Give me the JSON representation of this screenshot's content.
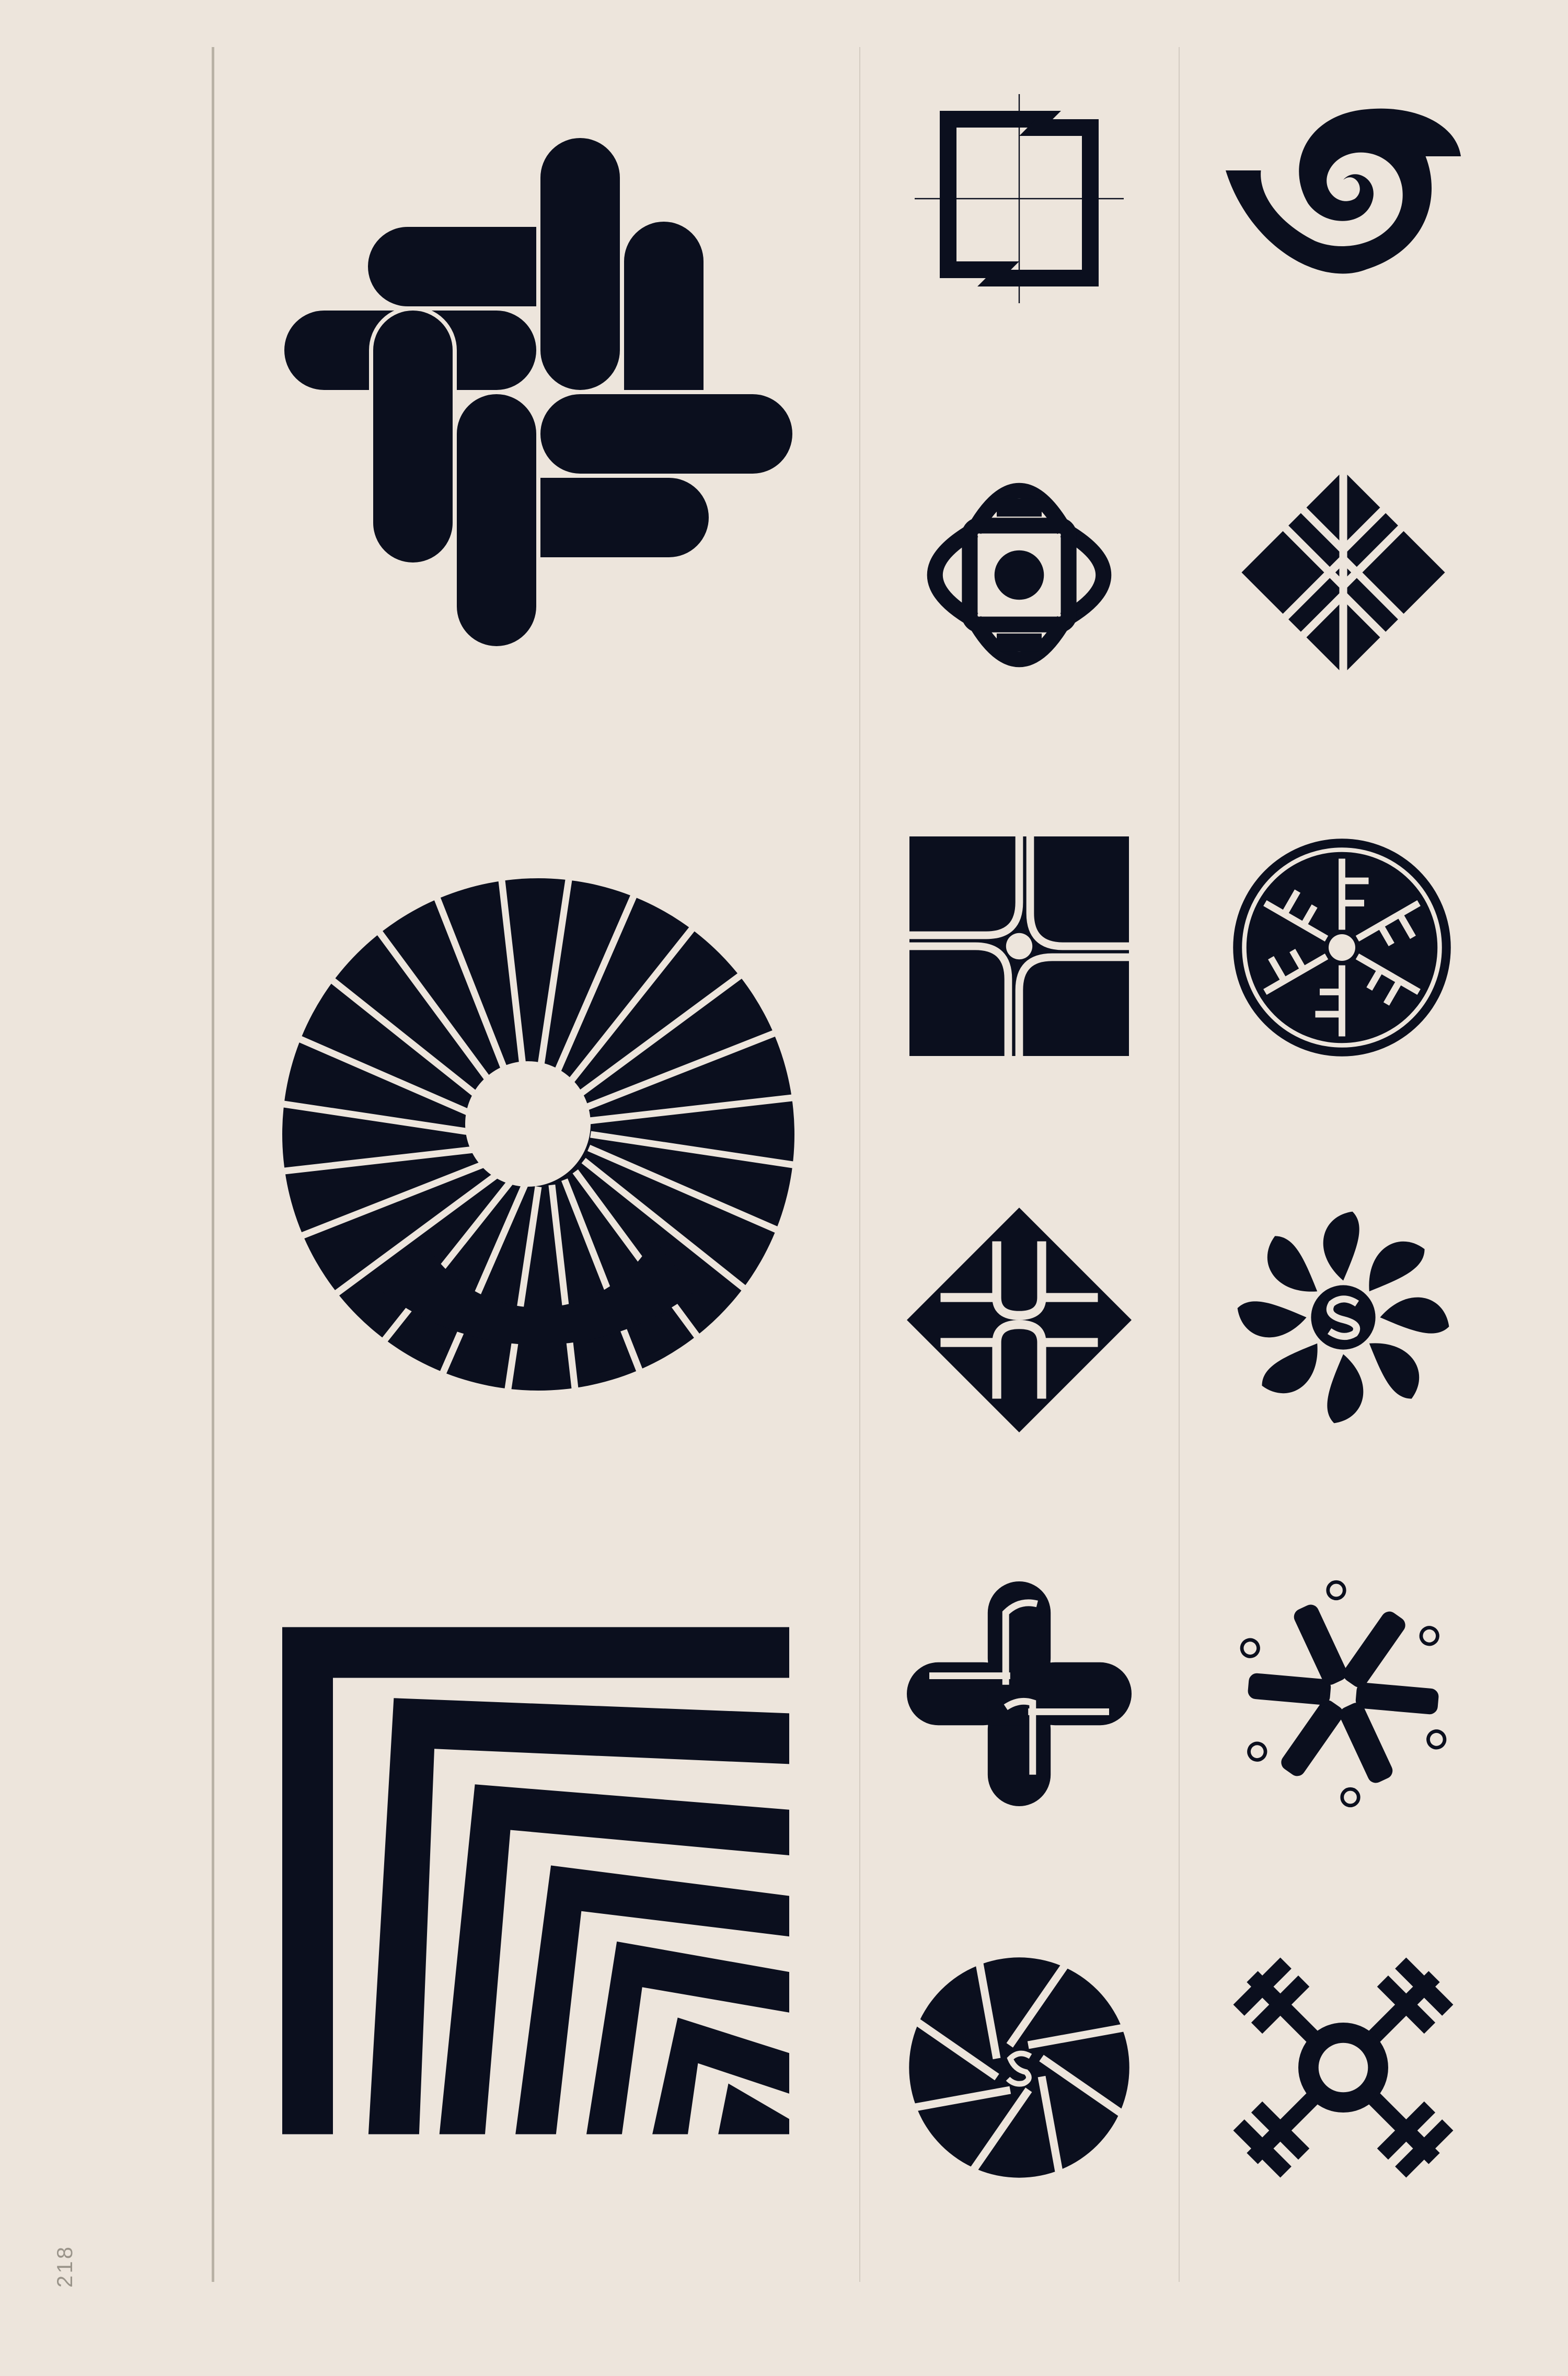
{
  "colors": {
    "background": "#ede5dc",
    "ink": "#0b0f1e",
    "rule": "#b9b2a6",
    "caption_name": "#1c2230",
    "caption_info": "#b4ada3"
  },
  "page": {
    "number": "218"
  },
  "logos": [
    {
      "id": "large-1",
      "icon": "interlocking-rounded-bars-icon",
      "name": "",
      "lines": [
        "",
        ""
      ]
    },
    {
      "id": "large-2",
      "icon": "radial-sunburst-ring-icon",
      "name": "",
      "lines": [
        "",
        ""
      ]
    },
    {
      "id": "large-3",
      "icon": "nested-corner-stripes-icon",
      "name": "",
      "lines": [
        "",
        ""
      ]
    },
    {
      "id": "r1c1",
      "icon": "rotating-arrows-crosshair-icon",
      "name": "",
      "lines": [
        "",
        "",
        ""
      ]
    },
    {
      "id": "r1c2",
      "icon": "spiral-swirl-icon",
      "name": "",
      "lines": [
        ""
      ]
    },
    {
      "id": "r2c1",
      "icon": "looped-quatrefoil-icon",
      "name": "",
      "lines": [
        "",
        ""
      ]
    },
    {
      "id": "r2c2",
      "icon": "diamond-m-pattern-icon",
      "name": "",
      "lines": [
        "",
        ""
      ]
    },
    {
      "id": "r3c1",
      "icon": "square-pinwheel-icon",
      "name": "",
      "lines": [
        "",
        ""
      ]
    },
    {
      "id": "r3c2",
      "icon": "circle-f-rosette-icon",
      "name": "",
      "lines": [
        "",
        ""
      ]
    },
    {
      "id": "r4c1",
      "icon": "diamond-s-knot-icon",
      "name": "",
      "lines": [
        "",
        ""
      ]
    },
    {
      "id": "r4c2",
      "icon": "s-petal-flower-icon",
      "name": "",
      "lines": [
        "",
        ""
      ]
    },
    {
      "id": "r5c1",
      "icon": "s-cross-knot-icon",
      "name": "",
      "lines": [
        "",
        ""
      ]
    },
    {
      "id": "r5c2",
      "icon": "triskelion-spokes-icon",
      "name": "",
      "lines": [
        "",
        ""
      ]
    },
    {
      "id": "r6c1",
      "icon": "aperture-shutter-icon",
      "name": "",
      "lines": [
        "",
        ""
      ]
    },
    {
      "id": "r6c2",
      "icon": "sun-cross-icon",
      "name": "",
      "lines": [
        ""
      ]
    }
  ]
}
